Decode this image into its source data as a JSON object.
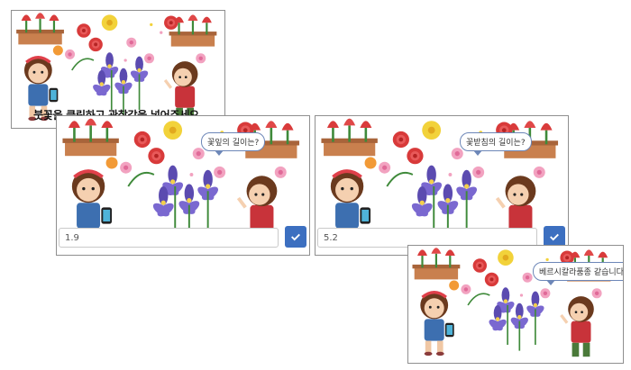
{
  "panels": [
    {
      "id": "p1",
      "caption": "붓꽃을 클릭하고 관찰값을 넣어주세요."
    },
    {
      "id": "p2",
      "bubble": "꽃잎의 길이는?",
      "input_value": "1.9",
      "submit_icon": "check-icon"
    },
    {
      "id": "p3",
      "bubble": "꽃받침의 길이는?",
      "input_value": "5.2",
      "submit_icon": "check-icon"
    },
    {
      "id": "p4",
      "bubble": "베르시칼라품종 같습니다."
    }
  ],
  "colors": {
    "button_blue": "#3c6fc0",
    "bubble_border": "#6d87b8",
    "iris_purple": "#5b4bb0",
    "tulip_red": "#d93b3b"
  }
}
